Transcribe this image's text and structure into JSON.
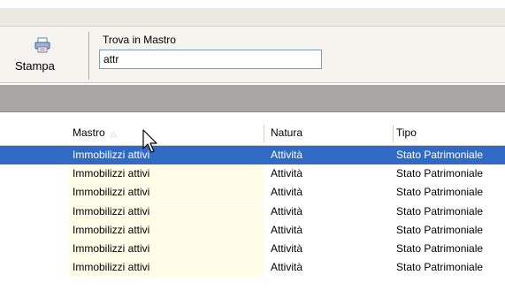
{
  "toolbar": {
    "print_label": "Stampa",
    "find_label": "Trova in Mastro",
    "find_value": "attr"
  },
  "table": {
    "columns": [
      {
        "label": "Mastro",
        "sort": "ascending"
      },
      {
        "label": "Natura"
      },
      {
        "label": "Tipo"
      }
    ],
    "rows": [
      [
        "Immobilizzi attivi",
        "Attività",
        "Stato Patrimoniale"
      ],
      [
        "Immobilizzi attivi",
        "Attività",
        "Stato Patrimoniale"
      ],
      [
        "Immobilizzi attivi",
        "Attività",
        "Stato Patrimoniale"
      ],
      [
        "Immobilizzi attivi",
        "Attività",
        "Stato Patrimoniale"
      ],
      [
        "Immobilizzi attivi",
        "Attività",
        "Stato Patrimoniale"
      ],
      [
        "Immobilizzi attivi",
        "Attività",
        "Stato Patrimoniale"
      ],
      [
        "Immobilizzi attivi",
        "Attività",
        "Stato Patrimoniale"
      ]
    ],
    "selected_row": 0
  },
  "colors": {
    "selection": "#316ac5",
    "sorted_column_band": "#fffde8",
    "groupbar": "#a8a7a4"
  },
  "icons": {
    "print": "printer-icon",
    "sort": "sort-ascending-icon",
    "cursor": "mouse-pointer-icon"
  }
}
